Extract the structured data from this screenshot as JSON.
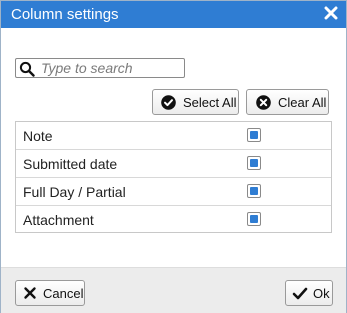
{
  "dialog": {
    "title": "Column settings",
    "close_icon": "close-icon"
  },
  "search": {
    "placeholder": "Type to search",
    "value": "",
    "icon": "search-icon"
  },
  "actions": {
    "select_all_label": "Select All",
    "select_all_icon": "check-circle-icon",
    "clear_all_label": "Clear All",
    "clear_all_icon": "x-circle-icon"
  },
  "columns": [
    {
      "label": "Note",
      "checked": true
    },
    {
      "label": "Submitted date",
      "checked": true
    },
    {
      "label": "Full Day / Partial",
      "checked": true
    },
    {
      "label": "Attachment",
      "checked": true
    }
  ],
  "footer": {
    "cancel_label": "Cancel",
    "cancel_icon": "x-icon",
    "ok_label": "Ok",
    "ok_icon": "checkmark-icon"
  },
  "colors": {
    "title_bar": "#2f7dd3",
    "checkbox_fill": "#2f7dd3",
    "footer_bg": "#ececec"
  }
}
